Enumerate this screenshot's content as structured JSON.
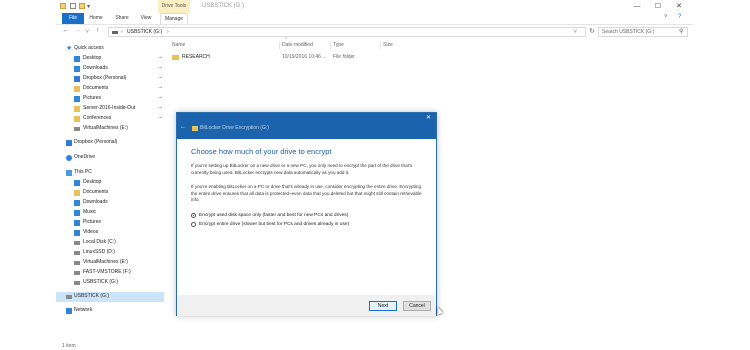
{
  "titlebar": {
    "drive_tools_label": "Drive Tools",
    "title": "USBSTICK (G:)",
    "minimize_glyph": "—",
    "maximize_glyph": "☐",
    "close_glyph": "✕"
  },
  "ribbon": {
    "tabs": [
      "File",
      "Home",
      "Share",
      "View",
      "Manage"
    ],
    "collapse_glyph": "˅",
    "help_glyph": "?"
  },
  "address_bar": {
    "back_glyph": "←",
    "forward_glyph": "→",
    "recent_glyph": "˅",
    "up_glyph": "↑",
    "path": "USBSTICK (G:)",
    "separator_glyph": "›",
    "dropdown_glyph": "˅",
    "refresh_glyph": "↻",
    "search_placeholder": "Search USBSTICK (G:)",
    "search_glyph": "⚲"
  },
  "nav_pane": {
    "items": [
      {
        "label": "Quick access",
        "icon": "star-icon",
        "pinned": false
      },
      {
        "label": "Desktop",
        "icon": "desktop-icon",
        "pinned": true
      },
      {
        "label": "Downloads",
        "icon": "downloads-icon",
        "pinned": true
      },
      {
        "label": "Dropbox (Personal)",
        "icon": "dropbox-icon",
        "pinned": true
      },
      {
        "label": "Documents",
        "icon": "documents-icon",
        "pinned": true
      },
      {
        "label": "Pictures",
        "icon": "pictures-icon",
        "pinned": true
      },
      {
        "label": "Server-2016-Inside-Out",
        "icon": "folder-icon",
        "pinned": true
      },
      {
        "label": "Conferences",
        "icon": "folder-icon",
        "pinned": true
      },
      {
        "label": "VirtualMachines (E:)",
        "icon": "drive-icon",
        "pinned": false
      },
      {
        "label": "Dropbox (Personal)",
        "icon": "dropbox-icon",
        "pinned": false
      },
      {
        "label": "OneDrive",
        "icon": "onedrive-icon",
        "pinned": false
      },
      {
        "label": "This PC",
        "icon": "this-pc-icon",
        "pinned": false
      },
      {
        "label": "Desktop",
        "icon": "desktop-icon",
        "pinned": false
      },
      {
        "label": "Documents",
        "icon": "documents-icon",
        "pinned": false
      },
      {
        "label": "Downloads",
        "icon": "downloads-icon",
        "pinned": false
      },
      {
        "label": "Music",
        "icon": "music-icon",
        "pinned": false
      },
      {
        "label": "Pictures",
        "icon": "pictures-icon",
        "pinned": false
      },
      {
        "label": "Videos",
        "icon": "videos-icon",
        "pinned": false
      },
      {
        "label": "Local Disk (C:)",
        "icon": "drive-icon",
        "pinned": false
      },
      {
        "label": "LinuxSSD (D:)",
        "icon": "drive-icon",
        "pinned": false
      },
      {
        "label": "VirtualMachines (E:)",
        "icon": "drive-icon",
        "pinned": false
      },
      {
        "label": "FAST-VMSTORE (F:)",
        "icon": "drive-icon",
        "pinned": false
      },
      {
        "label": "USBSTICK (G:)",
        "icon": "drive-icon",
        "pinned": false
      },
      {
        "label": "USBSTICK (G:)",
        "icon": "drive-icon",
        "pinned": false,
        "selected": true
      },
      {
        "label": "Network",
        "icon": "network-icon",
        "pinned": false
      }
    ],
    "pin_glyph": "⊸"
  },
  "file_list": {
    "sort_glyph": "^",
    "columns": [
      "Name",
      "Date modified",
      "Type",
      "Size"
    ],
    "rows": [
      {
        "name": "RESEARCH",
        "date": "10/19/2016 10:46 ...",
        "type": "File folder",
        "size": ""
      }
    ]
  },
  "status_bar": {
    "item_count": "1 item"
  },
  "dialog": {
    "back_glyph": "←",
    "title": "BitLocker Drive Encryption (G:)",
    "close_glyph": "✕",
    "heading": "Choose how much of your drive to encrypt",
    "paragraph1": "If you're setting up BitLocker on a new drive or a new PC, you only need to encrypt the part of the drive that's currently being used. BitLocker encrypts new data automatically as you add it.",
    "paragraph2": "If you're enabling BitLocker on a PC or drive that's already in use, consider encrypting the entire drive. Encrypting the entire drive ensures that all data is protected–even data that you deleted but that might still contain retrievable info.",
    "options": [
      {
        "label": "Encrypt used disk space only (faster and best for new PCs and drives)",
        "selected": true
      },
      {
        "label": "Encrypt entire drive (slower but best for PCs and drives already in use)",
        "selected": false
      }
    ],
    "next_label": "Next",
    "cancel_label": "Cancel"
  }
}
